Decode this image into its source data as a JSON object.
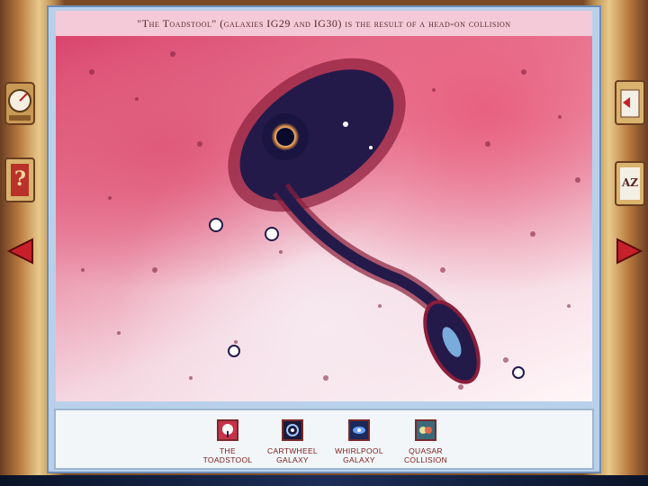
{
  "caption": "\"The Toadstool\" (galaxies IG29 and IG30) is the result of a head-on collision",
  "thumbnails": [
    {
      "label_line1": "THE",
      "label_line2": "TOADSTOOL",
      "icon": "toadstool-icon"
    },
    {
      "label_line1": "CARTWHEEL",
      "label_line2": "GALAXY",
      "icon": "cartwheel-galaxy-icon"
    },
    {
      "label_line1": "WHIRLPOOL",
      "label_line2": "GALAXY",
      "icon": "whirlpool-galaxy-icon"
    },
    {
      "label_line1": "QUASAR",
      "label_line2": "COLLISION",
      "icon": "quasar-collision-icon"
    }
  ],
  "side_controls": {
    "index_label": "AZ",
    "help_label": "?"
  },
  "colors": {
    "accent": "#b9d0ea",
    "caption_bg": "#f4c9d8",
    "label_text": "#7a1a1a"
  }
}
